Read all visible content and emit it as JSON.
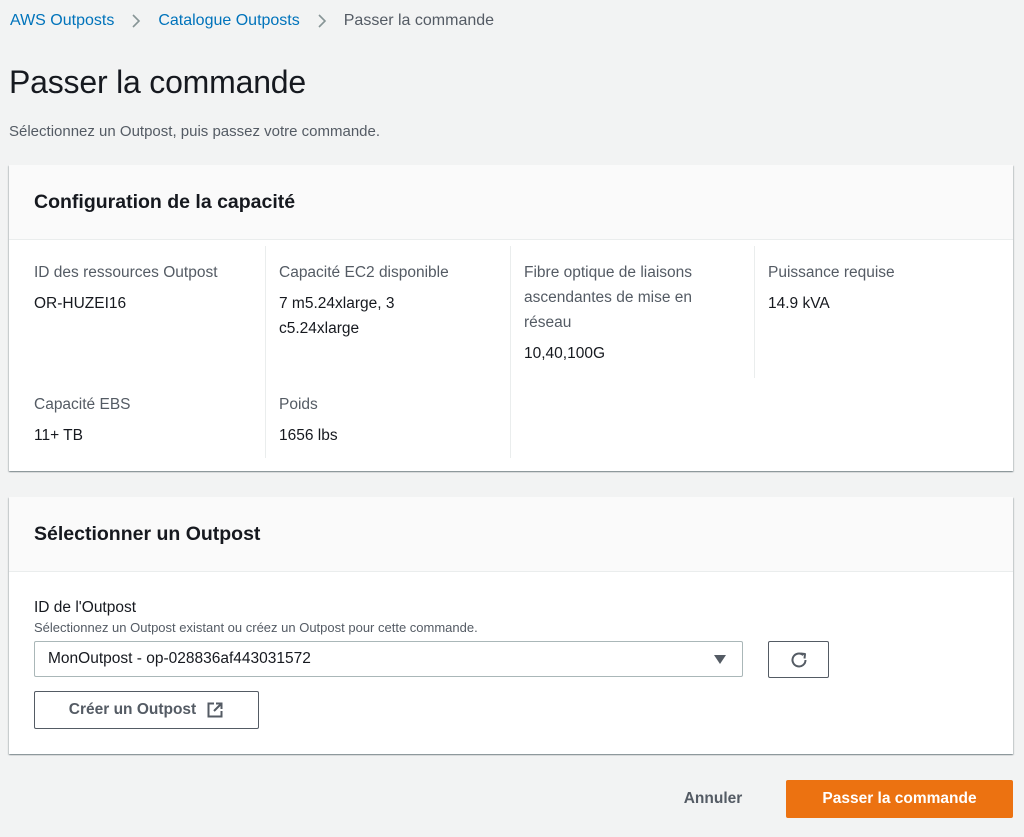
{
  "breadcrumb": {
    "items": [
      {
        "label": "AWS Outposts"
      },
      {
        "label": "Catalogue Outposts"
      },
      {
        "label": "Passer la commande"
      }
    ]
  },
  "page": {
    "title": "Passer la commande",
    "description": "Sélectionnez un Outpost, puis passez votre commande."
  },
  "capacity": {
    "title": "Configuration de la capacité",
    "fields": [
      {
        "label": "ID des ressources Outpost",
        "value": "OR-HUZEI16"
      },
      {
        "label": "Capacité EC2 disponible",
        "value": "7 m5.24xlarge, 3 c5.24xlarge"
      },
      {
        "label": "Fibre optique de liaisons ascendantes de mise en réseau",
        "value": "10,40,100G"
      },
      {
        "label": "Puissance requise",
        "value": "14.9 kVA"
      },
      {
        "label": "Capacité EBS",
        "value": "11+ TB"
      },
      {
        "label": "Poids",
        "value": "1656 lbs"
      }
    ]
  },
  "outpost": {
    "title": "Sélectionner un Outpost",
    "field_label": "ID de l'Outpost",
    "field_description": "Sélectionnez un Outpost existant ou créez un Outpost pour cette commande.",
    "selected_value": "MonOutpost - op-028836af443031572",
    "create_label": "Créer un Outpost"
  },
  "footer": {
    "cancel_label": "Annuler",
    "submit_label": "Passer la commande"
  },
  "colors": {
    "link": "#0073bb",
    "primary": "#ec7211",
    "text_secondary": "#545b64"
  },
  "icons": [
    "chevron-right-icon",
    "caret-down-icon",
    "refresh-icon",
    "external-link-icon"
  ]
}
